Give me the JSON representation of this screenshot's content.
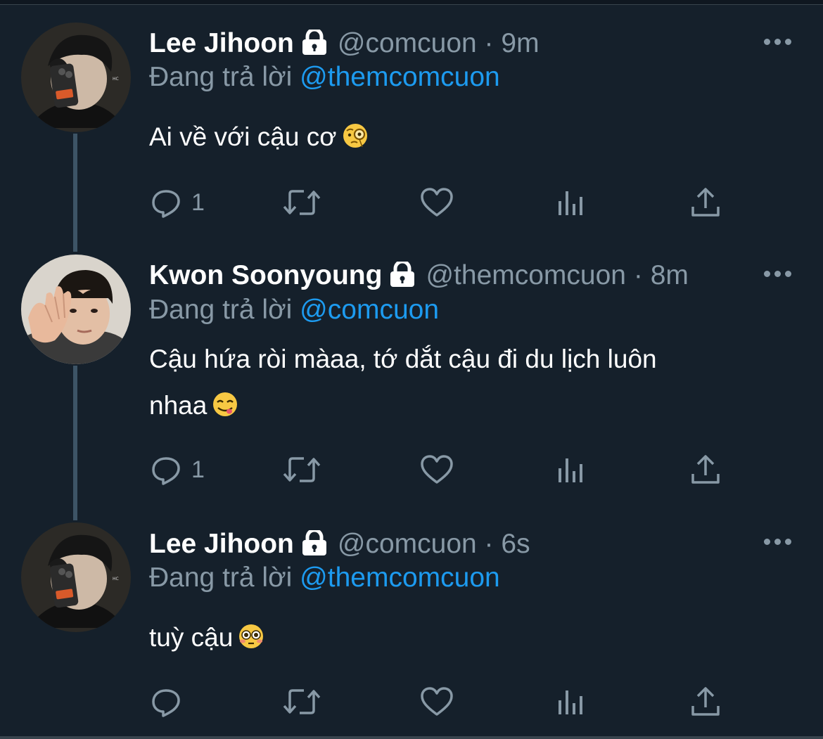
{
  "colors": {
    "background": "#15202b",
    "secondary_text": "#8899a6",
    "mention": "#1d9bf0",
    "thread_line": "#3d5466"
  },
  "tweets": [
    {
      "name": "Lee Jihoon",
      "handle": "@comcuon",
      "sep": "·",
      "time": "9m",
      "reply_prefix": "Đang trả lời",
      "reply_to": "@themcomcuon",
      "text_lines": [
        "Ai về với cậu cơ"
      ],
      "emoji": "face-with-monocle",
      "reply_count": "1",
      "avatar": "avatar-lee-jihoon"
    },
    {
      "name": "Kwon Soonyoung",
      "handle": "@themcomcuon",
      "sep": "·",
      "time": "8m",
      "reply_prefix": "Đang trả lời",
      "reply_to": "@comcuon",
      "text_lines": [
        "Cậu hứa ròi màaa, tớ dắt cậu đi du lịch luôn",
        "nhaa"
      ],
      "emoji": "face-savoring-food",
      "reply_count": "1",
      "avatar": "avatar-kwon-soonyoung"
    },
    {
      "name": "Lee Jihoon",
      "handle": "@comcuon",
      "sep": "·",
      "time": "6s",
      "reply_prefix": "Đang trả lời",
      "reply_to": "@themcomcuon",
      "text_lines": [
        "tuỳ cậu"
      ],
      "emoji": "flushed-face",
      "reply_count": "",
      "avatar": "avatar-lee-jihoon"
    }
  ]
}
